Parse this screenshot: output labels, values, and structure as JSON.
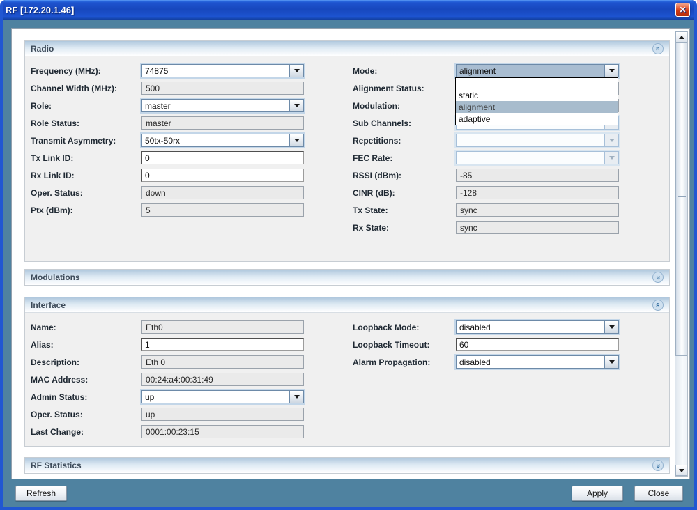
{
  "window": {
    "title": "RF [172.20.1.46]",
    "close_glyph": "✕"
  },
  "sections": {
    "radio": {
      "title": "Radio"
    },
    "modulations": {
      "title": "Modulations"
    },
    "interface": {
      "title": "Interface"
    },
    "rf_statistics": {
      "title": "RF Statistics"
    }
  },
  "radio": {
    "left": [
      {
        "label": "Frequency (MHz):",
        "value": "74875"
      },
      {
        "label": "Channel Width (MHz):",
        "value": "500"
      },
      {
        "label": "Role:",
        "value": "master"
      },
      {
        "label": "Role Status:",
        "value": "master"
      },
      {
        "label": "Transmit Asymmetry:",
        "value": "50tx-50rx"
      },
      {
        "label": "Tx Link ID:",
        "value": "0"
      },
      {
        "label": "Rx Link ID:",
        "value": "0"
      },
      {
        "label": "Oper. Status:",
        "value": "down"
      },
      {
        "label": "Ptx (dBm):",
        "value": "5"
      }
    ],
    "right": [
      {
        "label": "Mode:",
        "value": "alignment"
      },
      {
        "label": "Alignment Status:",
        "value": ""
      },
      {
        "label": "Modulation:",
        "value": ""
      },
      {
        "label": "Sub Channels:",
        "value": ""
      },
      {
        "label": "Repetitions:",
        "value": ""
      },
      {
        "label": "FEC Rate:",
        "value": ""
      },
      {
        "label": "RSSI (dBm):",
        "value": "-85"
      },
      {
        "label": "CINR (dB):",
        "value": "-128"
      },
      {
        "label": "Tx State:",
        "value": "sync"
      },
      {
        "label": "Rx State:",
        "value": "sync"
      }
    ],
    "mode_popup": {
      "options": [
        "",
        "static",
        "alignment",
        "adaptive"
      ],
      "selected": "alignment"
    }
  },
  "interface": {
    "left": [
      {
        "label": "Name:",
        "value": "Eth0"
      },
      {
        "label": "Alias:",
        "value": "1"
      },
      {
        "label": "Description:",
        "value": "Eth 0"
      },
      {
        "label": "MAC Address:",
        "value": "00:24:a4:00:31:49"
      },
      {
        "label": "Admin Status:",
        "value": "up"
      },
      {
        "label": "Oper. Status:",
        "value": "up"
      },
      {
        "label": "Last Change:",
        "value": "0001:00:23:15"
      }
    ],
    "right": [
      {
        "label": "Loopback Mode:",
        "value": "disabled"
      },
      {
        "label": "Loopback Timeout:",
        "value": "60"
      },
      {
        "label": "Alarm Propagation:",
        "value": "disabled"
      }
    ]
  },
  "footer": {
    "refresh": "Refresh",
    "apply": "Apply",
    "close": "Close"
  }
}
